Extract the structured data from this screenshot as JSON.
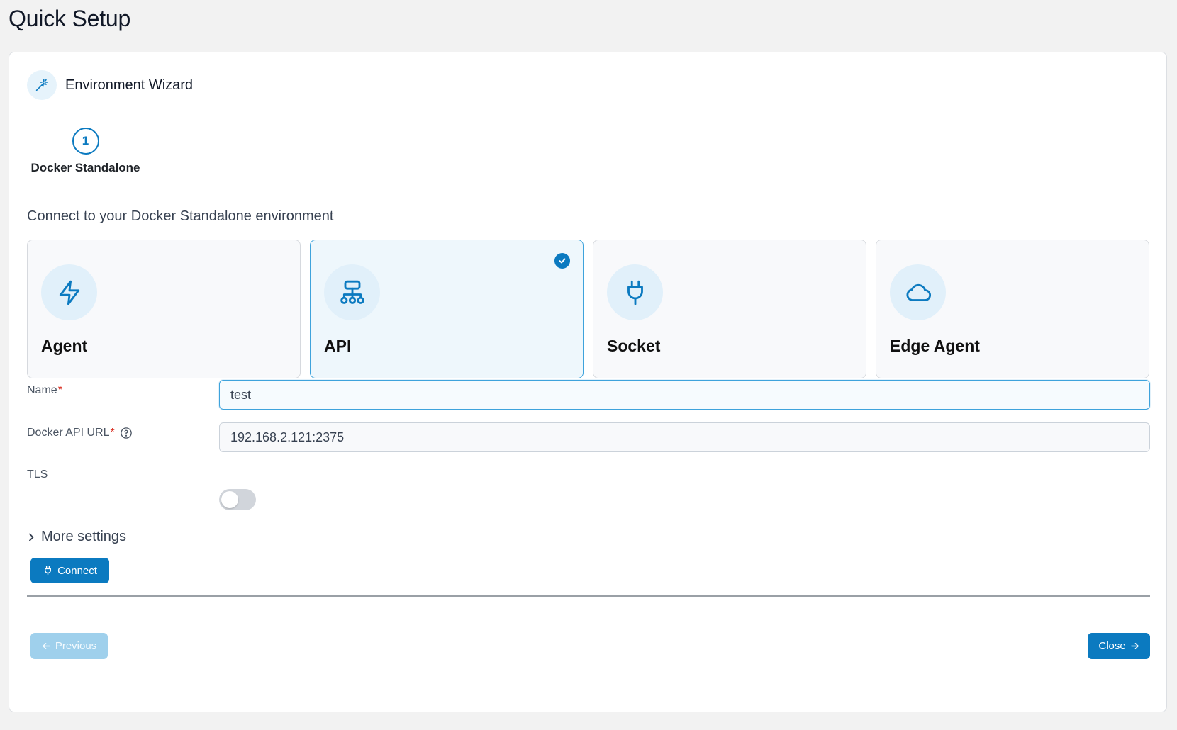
{
  "page": {
    "title": "Quick Setup"
  },
  "wizard": {
    "title": "Environment Wizard",
    "icon": "magic-wand-icon",
    "steps": [
      {
        "number": "1",
        "label": "Docker Standalone",
        "active": true
      }
    ]
  },
  "connect": {
    "heading": "Connect to your Docker Standalone environment",
    "options": [
      {
        "label": "Agent",
        "icon": "lightning-icon",
        "selected": false
      },
      {
        "label": "API",
        "icon": "network-icon",
        "selected": true
      },
      {
        "label": "Socket",
        "icon": "plug-icon",
        "selected": false
      },
      {
        "label": "Edge Agent",
        "icon": "cloud-icon",
        "selected": false
      }
    ]
  },
  "form": {
    "name": {
      "label": "Name",
      "required_mark": "*",
      "value": "test"
    },
    "docker_api_url": {
      "label": "Docker API URL",
      "required_mark": "*",
      "value": "192.168.2.121:2375"
    },
    "tls": {
      "label": "TLS",
      "enabled": false
    },
    "more_settings": {
      "label": "More settings",
      "expanded": false
    }
  },
  "actions": {
    "connect_label": "Connect",
    "previous_label": "Previous",
    "close_label": "Close"
  },
  "colors": {
    "accent": "#0b7ac0",
    "selected_border": "#3ea3dc",
    "icon_bg": "#e1f0fa",
    "required": "#d92d20"
  }
}
